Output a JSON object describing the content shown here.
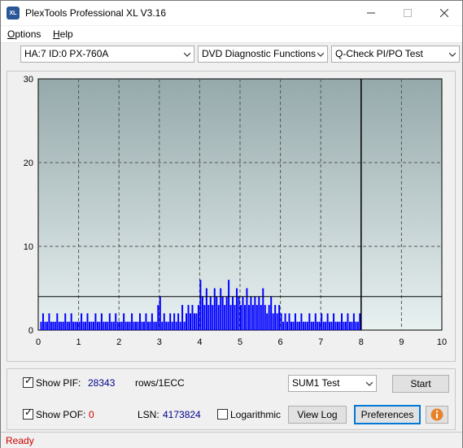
{
  "window": {
    "title": "PlexTools Professional XL V3.16",
    "icon_text": "XL"
  },
  "menu": {
    "options": "ptions",
    "options_accel": "O",
    "help": "elp",
    "help_accel": "H"
  },
  "toolbar": {
    "drive": "HA:7 ID:0  PX-760A",
    "function": "DVD Diagnostic Functions",
    "test": "Q-Check PI/PO Test"
  },
  "chart_data": {
    "type": "bar",
    "x_ticks": [
      "0",
      "1",
      "2",
      "3",
      "4",
      "5",
      "6",
      "7",
      "8",
      "9",
      "10"
    ],
    "y_ticks": [
      "0",
      "10",
      "20",
      "30"
    ],
    "xlim": [
      0,
      10
    ],
    "ylim": [
      0,
      30
    ],
    "threshold": 4,
    "marker_x": 8,
    "grid": true,
    "background_gradient": [
      "#95a9ab",
      "#e9f1f1"
    ],
    "bar_color": "#0000ff",
    "bars": [
      [
        0.05,
        1
      ],
      [
        0.1,
        2
      ],
      [
        0.15,
        1
      ],
      [
        0.2,
        1
      ],
      [
        0.25,
        2
      ],
      [
        0.3,
        1
      ],
      [
        0.35,
        1
      ],
      [
        0.4,
        1
      ],
      [
        0.45,
        2
      ],
      [
        0.5,
        1
      ],
      [
        0.55,
        1
      ],
      [
        0.6,
        1
      ],
      [
        0.65,
        2
      ],
      [
        0.7,
        1
      ],
      [
        0.75,
        1
      ],
      [
        0.8,
        2
      ],
      [
        0.85,
        1
      ],
      [
        0.9,
        1
      ],
      [
        0.95,
        1
      ],
      [
        1.0,
        1
      ],
      [
        1.05,
        2
      ],
      [
        1.1,
        1
      ],
      [
        1.15,
        1
      ],
      [
        1.2,
        2
      ],
      [
        1.25,
        1
      ],
      [
        1.3,
        1
      ],
      [
        1.35,
        1
      ],
      [
        1.4,
        2
      ],
      [
        1.45,
        1
      ],
      [
        1.5,
        1
      ],
      [
        1.55,
        2
      ],
      [
        1.6,
        1
      ],
      [
        1.65,
        1
      ],
      [
        1.7,
        1
      ],
      [
        1.75,
        2
      ],
      [
        1.8,
        1
      ],
      [
        1.85,
        1
      ],
      [
        1.9,
        2
      ],
      [
        1.95,
        1
      ],
      [
        2.0,
        1
      ],
      [
        2.05,
        1
      ],
      [
        2.1,
        2
      ],
      [
        2.15,
        1
      ],
      [
        2.2,
        1
      ],
      [
        2.25,
        1
      ],
      [
        2.3,
        2
      ],
      [
        2.35,
        1
      ],
      [
        2.4,
        1
      ],
      [
        2.45,
        1
      ],
      [
        2.5,
        2
      ],
      [
        2.55,
        1
      ],
      [
        2.6,
        1
      ],
      [
        2.65,
        2
      ],
      [
        2.7,
        1
      ],
      [
        2.75,
        1
      ],
      [
        2.8,
        2
      ],
      [
        2.85,
        1
      ],
      [
        2.9,
        1
      ],
      [
        2.95,
        3
      ],
      [
        3.0,
        4
      ],
      [
        3.05,
        1
      ],
      [
        3.1,
        2
      ],
      [
        3.15,
        1
      ],
      [
        3.2,
        1
      ],
      [
        3.25,
        2
      ],
      [
        3.3,
        1
      ],
      [
        3.35,
        2
      ],
      [
        3.4,
        1
      ],
      [
        3.45,
        2
      ],
      [
        3.5,
        1
      ],
      [
        3.55,
        3
      ],
      [
        3.6,
        1
      ],
      [
        3.65,
        2
      ],
      [
        3.7,
        3
      ],
      [
        3.75,
        2
      ],
      [
        3.8,
        3
      ],
      [
        3.85,
        2
      ],
      [
        3.9,
        2
      ],
      [
        3.95,
        3
      ],
      [
        4.0,
        6
      ],
      [
        4.05,
        4
      ],
      [
        4.1,
        3
      ],
      [
        4.15,
        5
      ],
      [
        4.2,
        3
      ],
      [
        4.25,
        4
      ],
      [
        4.3,
        3
      ],
      [
        4.35,
        5
      ],
      [
        4.4,
        4
      ],
      [
        4.45,
        3
      ],
      [
        4.5,
        5
      ],
      [
        4.55,
        4
      ],
      [
        4.6,
        3
      ],
      [
        4.65,
        4
      ],
      [
        4.7,
        6
      ],
      [
        4.75,
        3
      ],
      [
        4.8,
        4
      ],
      [
        4.85,
        3
      ],
      [
        4.9,
        5
      ],
      [
        4.95,
        4
      ],
      [
        5.0,
        3
      ],
      [
        5.05,
        4
      ],
      [
        5.1,
        3
      ],
      [
        5.15,
        5
      ],
      [
        5.2,
        3
      ],
      [
        5.25,
        4
      ],
      [
        5.3,
        3
      ],
      [
        5.35,
        4
      ],
      [
        5.4,
        3
      ],
      [
        5.45,
        4
      ],
      [
        5.5,
        3
      ],
      [
        5.55,
        5
      ],
      [
        5.6,
        3
      ],
      [
        5.65,
        2
      ],
      [
        5.7,
        3
      ],
      [
        5.75,
        4
      ],
      [
        5.8,
        2
      ],
      [
        5.85,
        3
      ],
      [
        5.9,
        2
      ],
      [
        5.95,
        3
      ],
      [
        6.0,
        2
      ],
      [
        6.05,
        1
      ],
      [
        6.1,
        2
      ],
      [
        6.15,
        1
      ],
      [
        6.2,
        2
      ],
      [
        6.25,
        1
      ],
      [
        6.3,
        1
      ],
      [
        6.35,
        2
      ],
      [
        6.4,
        1
      ],
      [
        6.45,
        1
      ],
      [
        6.5,
        2
      ],
      [
        6.55,
        1
      ],
      [
        6.6,
        1
      ],
      [
        6.65,
        1
      ],
      [
        6.7,
        2
      ],
      [
        6.75,
        1
      ],
      [
        6.8,
        1
      ],
      [
        6.85,
        2
      ],
      [
        6.9,
        1
      ],
      [
        6.95,
        1
      ],
      [
        7.0,
        2
      ],
      [
        7.05,
        1
      ],
      [
        7.1,
        1
      ],
      [
        7.15,
        2
      ],
      [
        7.2,
        1
      ],
      [
        7.25,
        1
      ],
      [
        7.3,
        2
      ],
      [
        7.35,
        1
      ],
      [
        7.4,
        1
      ],
      [
        7.45,
        1
      ],
      [
        7.5,
        2
      ],
      [
        7.55,
        1
      ],
      [
        7.6,
        1
      ],
      [
        7.65,
        2
      ],
      [
        7.7,
        1
      ],
      [
        7.75,
        1
      ],
      [
        7.8,
        2
      ],
      [
        7.85,
        1
      ],
      [
        7.9,
        1
      ],
      [
        7.95,
        2
      ]
    ]
  },
  "controls": {
    "show_pif_label": "Show PIF:",
    "pif_value": "28343",
    "pif_unit": "rows/1ECC",
    "show_pof_label": "Show POF:",
    "pof_value": "0",
    "lsn_label": "LSN:",
    "lsn_value": "4173824",
    "logarithmic_label": "Logarithmic",
    "test_select": "SUM1 Test",
    "start_label": "Start",
    "view_log_label": "View Log",
    "preferences_label": "Preferences",
    "pif_checked": true,
    "pof_checked": true,
    "log_checked": false
  },
  "status": {
    "text": "Ready"
  },
  "colors": {
    "pif_value": "#00008b",
    "pof_value": "#d00000",
    "lsn_value": "#00008b",
    "status": "#d00000",
    "info_button": "#e8832a"
  }
}
